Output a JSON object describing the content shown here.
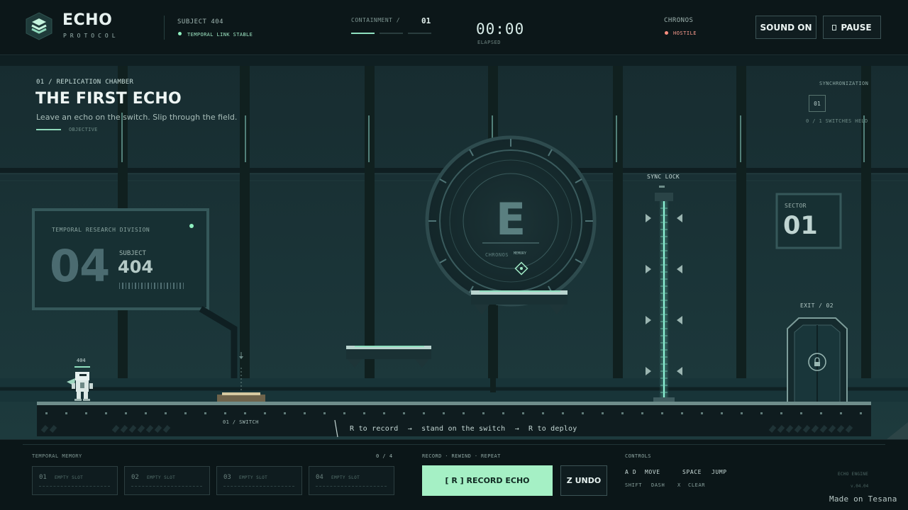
{
  "header": {
    "title": "ECHO",
    "subtitle": "PROTOCOL",
    "subject": "SUBJECT 404",
    "link_status": "TEMPORAL LINK STABLE",
    "containment_label": "CONTAINMENT /",
    "containment_value": "01",
    "containment_progress": {
      "filled": 1,
      "total": 3
    },
    "timer": "00:00",
    "timer_label": "ELAPSED",
    "chronos_label": "CHRONOS",
    "chronos_status": "HOSTILE",
    "sound_button": "SOUND ON",
    "pause_button": "PAUSE"
  },
  "level": {
    "tag": "01 / REPLICATION CHAMBER",
    "title": "THE FIRST ECHO",
    "instruction": "Leave an echo on the switch. Slip through the field.",
    "objective_label": "OBJECTIVE"
  },
  "sync": {
    "label": "SYNCHRONIZATION",
    "box": "01",
    "count": "0 / 1 SWITCHES HELD"
  },
  "panel": {
    "division": "TEMPORAL RESEARCH DIVISION",
    "number": "04",
    "subject_label": "SUBJECT",
    "subject_value": "404"
  },
  "sector": {
    "label": "SECTOR",
    "value": "01"
  },
  "portal": {
    "letter": "E",
    "sub": "CHRONOS",
    "memory": "MEMORY"
  },
  "world": {
    "sync_lock": "SYNC LOCK",
    "exit": "EXIT / 02",
    "switch": "01 / SWITCH",
    "player_tag": "404"
  },
  "hint": {
    "step1": "R to record",
    "arrow": "→",
    "step2": "stand on the switch",
    "step3": "R to deploy"
  },
  "memory": {
    "label": "TEMPORAL MEMORY",
    "count": "0 / 4",
    "slots": [
      {
        "num": "01",
        "text": "EMPTY SLOT"
      },
      {
        "num": "02",
        "text": "EMPTY SLOT"
      },
      {
        "num": "03",
        "text": "EMPTY SLOT"
      },
      {
        "num": "04",
        "text": "EMPTY SLOT"
      }
    ]
  },
  "actions": {
    "label": "RECORD · REWIND · REPEAT",
    "record": "[ R ]  RECORD ECHO",
    "undo": "Z  UNDO"
  },
  "controls": {
    "label": "CONTROLS",
    "ad": "A D",
    "move": "MOVE",
    "space": "SPACE",
    "jump": "JUMP",
    "shift": "SHIFT",
    "dash": "DASH",
    "x": "X",
    "clear": "CLEAR"
  },
  "footer": {
    "engine": "ECHO ENGINE",
    "version": "v.04.04",
    "made_on": "Made on Tesana"
  },
  "colors": {
    "accent": "#a5f0c5",
    "hostile": "#ff8f80",
    "background": "#0d1a1d",
    "field": "#7ff0d0"
  },
  "icons": {
    "logo": "hexagon-chevron-icon",
    "pause": "pause-icon",
    "lock": "lock-icon",
    "diamond": "diamond-icon"
  }
}
